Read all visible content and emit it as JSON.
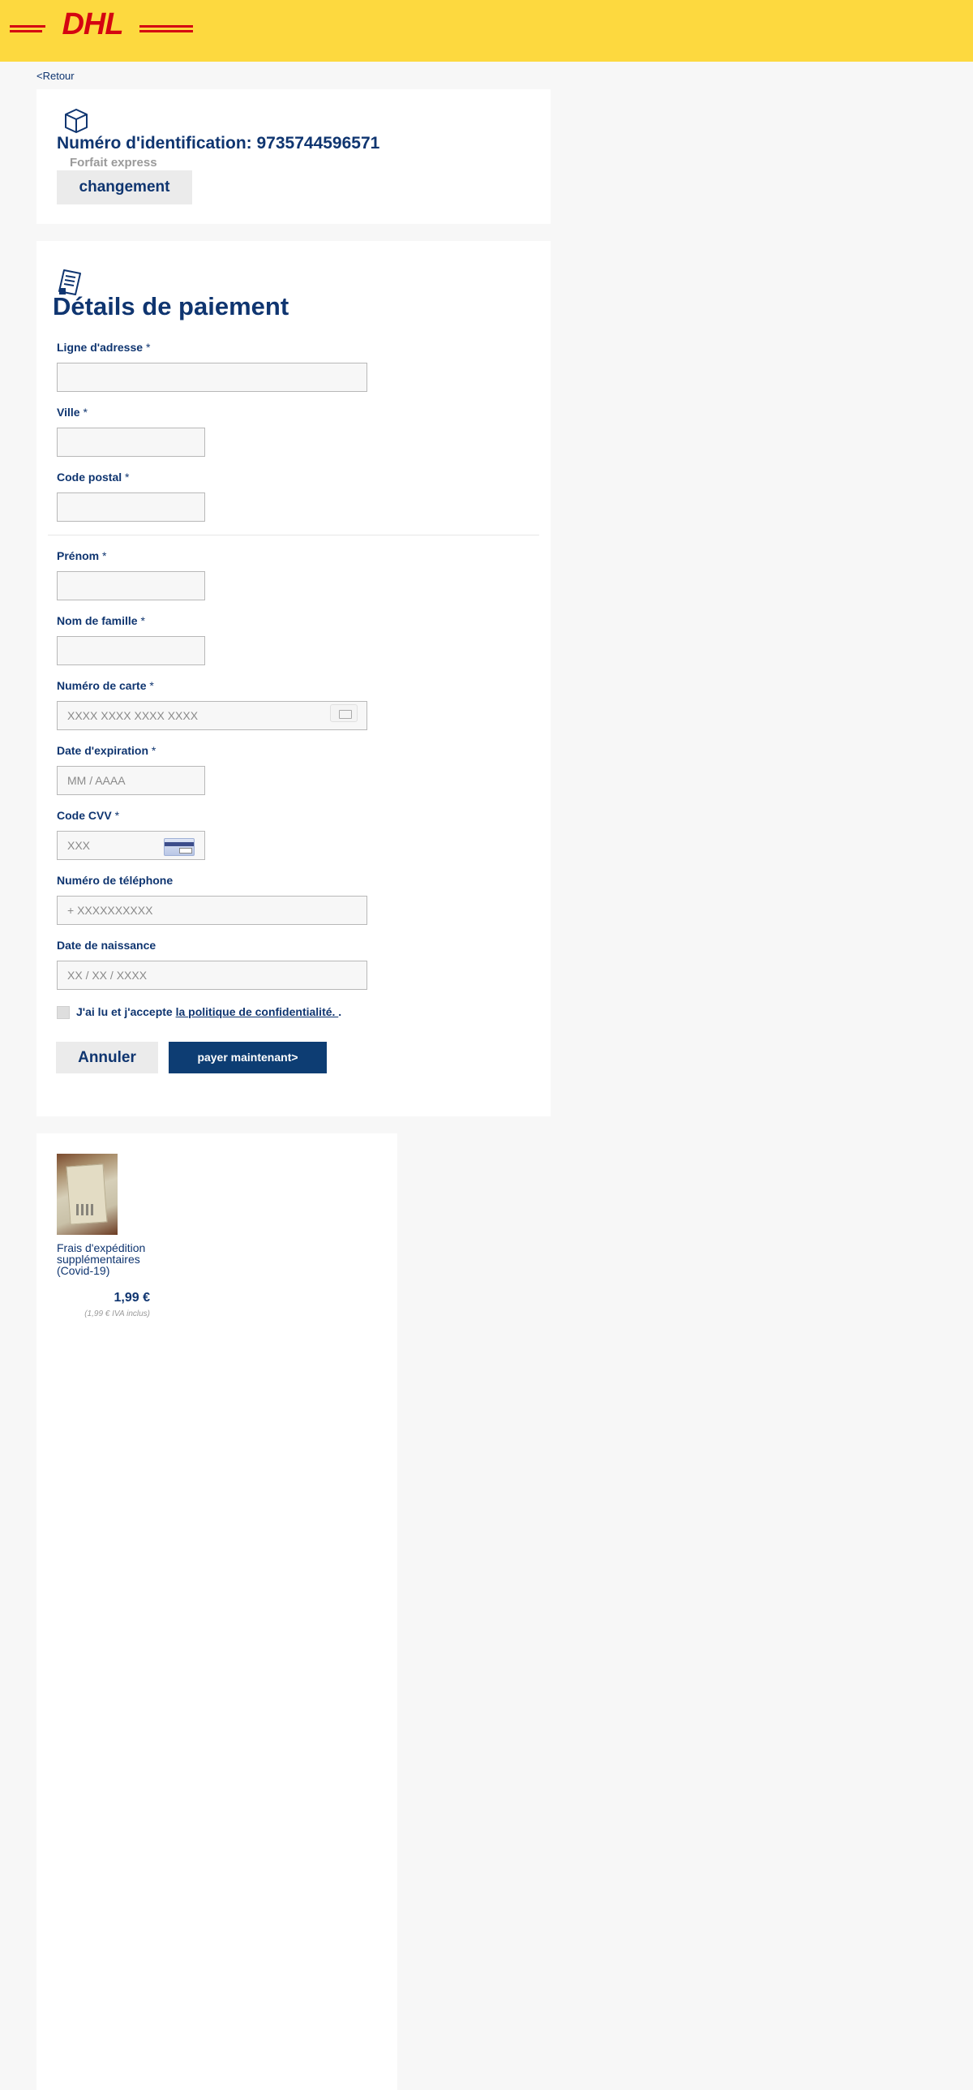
{
  "header": {
    "logo_text": "DHL",
    "logo_colors": {
      "background": "#fdd93f",
      "mark": "#d40511"
    }
  },
  "nav": {
    "back_label": "<Retour"
  },
  "tracking": {
    "icon": "package-icon",
    "title": "Numéro d'identification: 9735744596571",
    "subtitle": "Forfait express",
    "change_button": "changement"
  },
  "payment": {
    "icon": "document-icon",
    "title": "Détails de paiement",
    "fields": {
      "address": {
        "label": "Ligne d'adresse",
        "required": "*",
        "placeholder": ""
      },
      "city": {
        "label": "Ville",
        "required": "*",
        "placeholder": ""
      },
      "postal": {
        "label": "Code postal",
        "required": "*",
        "placeholder": ""
      },
      "first_name": {
        "label": "Prénom",
        "required": "*",
        "placeholder": ""
      },
      "last_name": {
        "label": "Nom de famille",
        "required": "*",
        "placeholder": ""
      },
      "card_number": {
        "label": "Numéro de carte",
        "required": "*",
        "placeholder": "XXXX XXXX XXXX XXXX"
      },
      "expiry": {
        "label": "Date d'expiration",
        "required": "*",
        "placeholder": "MM / AAAA"
      },
      "cvv": {
        "label": "Code CVV",
        "required": "*",
        "placeholder": "XXX"
      },
      "phone": {
        "label": "Numéro de téléphone",
        "placeholder": "+ XXXXXXXXXX"
      },
      "birth": {
        "label": "Date de naissance",
        "placeholder": "XX / XX / XXXX"
      }
    },
    "consent": {
      "text": "J'ai lu et j'accepte ",
      "link": "la politique de confidentialité. ",
      "suffix": "."
    },
    "cancel_button": "Annuler",
    "pay_button": "payer maintenant>",
    "accent_color": "#0d3d73"
  },
  "cart": {
    "item": {
      "name": "Frais d'expédition supplémentaires (Covid-19)",
      "price": "1,99 €",
      "vat_note": "(1,99 € IVA inclus)"
    }
  }
}
